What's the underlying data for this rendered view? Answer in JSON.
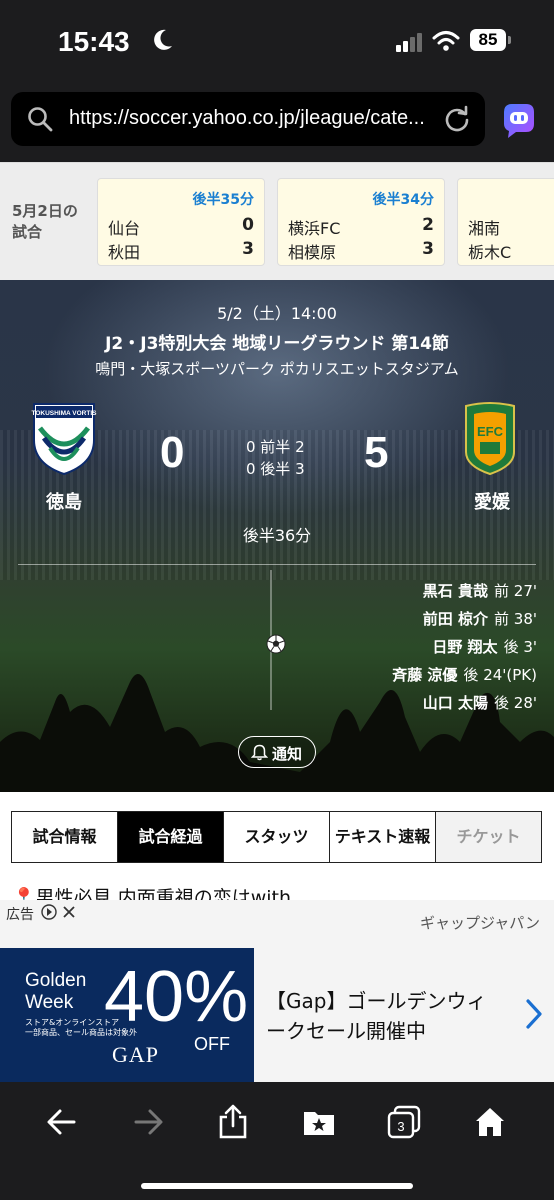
{
  "status_bar": {
    "time": "15:43",
    "battery": "85",
    "focus_icon": "moon-icon"
  },
  "browser": {
    "url": "https://soccer.yahoo.co.jp/jleague/cate..."
  },
  "other_matches": {
    "date_label_1": "5月2日の",
    "date_label_2": "試合",
    "cards": [
      {
        "status": "後半35分",
        "home": "仙台",
        "home_score": "0",
        "away": "秋田",
        "away_score": "3"
      },
      {
        "status": "後半34分",
        "home": "横浜FC",
        "home_score": "2",
        "away": "相模原",
        "away_score": "3"
      },
      {
        "status": "",
        "home": "湘南",
        "home_score": "",
        "away": "栃木C",
        "away_score": ""
      }
    ]
  },
  "match": {
    "date": "5/2（土）14:00",
    "competition": "J2・J3特別大会 地域リーグラウンド 第14節",
    "venue": "鳴門・大塚スポーツパーク ポカリスエットスタジアム",
    "home_team": "徳島",
    "away_team": "愛媛",
    "home_score": "0",
    "away_score": "5",
    "first_half": "0 前半 2",
    "second_half": "0 後半 3",
    "clock": "後半36分",
    "home_logo_text": "TOKUSHIMA VORTIS",
    "away_logo_text": "EFC",
    "scorers": [
      {
        "name": "黒石 貴哉",
        "time": "前 27'"
      },
      {
        "name": "前田 椋介",
        "time": "前 38'"
      },
      {
        "name": "日野 翔太",
        "time": "後 3'"
      },
      {
        "name": "斉藤 涼優",
        "time": "後 24'(PK)"
      },
      {
        "name": "山口 太陽",
        "time": "後 28'"
      }
    ],
    "notify_label": "通知"
  },
  "tabs": [
    "試合情報",
    "試合経過",
    "スタッツ",
    "テキスト速報",
    "チケット"
  ],
  "active_tab": "試合経過",
  "promo_text": "男性必見 内面重視の恋はwith",
  "ad": {
    "label": "広告",
    "sponsor": "ギャップジャパン",
    "banner_gw": "Golden\nWeek",
    "banner_small": "ストア&オンラインストア\n一部商品、セール商品は対象外",
    "banner_pct": "40%",
    "banner_off": "OFF",
    "banner_brand": "GAP",
    "text": "【Gap】ゴールデンウィークセール開催中"
  },
  "toolbar": {
    "tab_count": "3",
    "icons": [
      "back-icon",
      "forward-icon",
      "share-icon",
      "bookmarks-icon",
      "tabs-icon",
      "home-icon"
    ]
  },
  "colors": {
    "status_blue": "#1a7fd1",
    "card_bg": "#fffbe4",
    "board_bg": "#2a3548",
    "ad_navy": "#0a2a5e",
    "promo_pin": "#e8302a"
  }
}
